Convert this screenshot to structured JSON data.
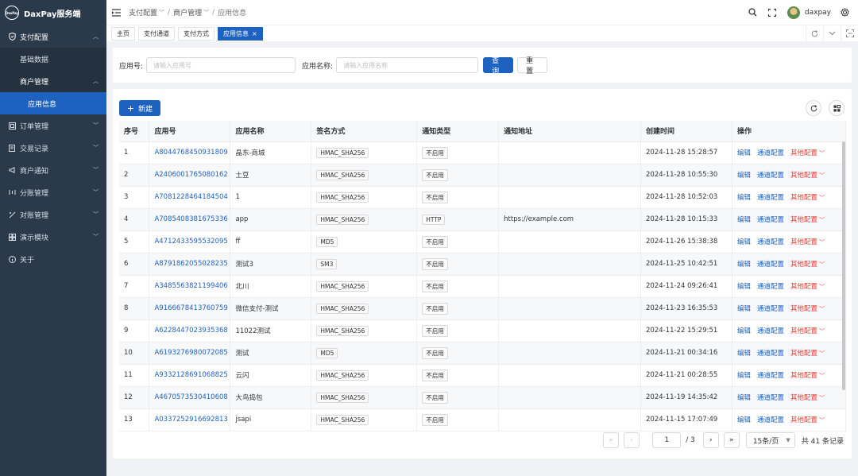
{
  "app": {
    "logo_mark": "DaxPay",
    "title": "DaxPay服务端"
  },
  "sidebar": {
    "items": [
      {
        "label": "支付配置",
        "icon": "shield-icon",
        "state": "expanded"
      },
      {
        "label": "基础数据",
        "level": 1
      },
      {
        "label": "商户管理",
        "level": 1,
        "state": "expanded"
      },
      {
        "label": "应用信息",
        "level": 2,
        "active": true
      },
      {
        "label": "订单管理",
        "icon": "order-icon"
      },
      {
        "label": "交易记录",
        "icon": "record-icon"
      },
      {
        "label": "商户通知",
        "icon": "notify-icon"
      },
      {
        "label": "分账管理",
        "icon": "split-icon"
      },
      {
        "label": "对账管理",
        "icon": "reconcile-icon"
      },
      {
        "label": "演示模块",
        "icon": "demo-icon"
      },
      {
        "label": "关于",
        "icon": "info-icon"
      }
    ]
  },
  "topbar": {
    "breadcrumb": [
      "支付配置",
      "商户管理",
      "应用信息"
    ],
    "username": "daxpay"
  },
  "tabs": [
    {
      "label": "主页"
    },
    {
      "label": "支付通道"
    },
    {
      "label": "支付方式"
    },
    {
      "label": "应用信息",
      "active": true
    }
  ],
  "search": {
    "app_no_label": "应用号:",
    "app_no_placeholder": "请输入应用号",
    "app_name_label": "应用名称:",
    "app_name_placeholder": "请输入应用名称",
    "query_button": "查询",
    "reset_button": "重置"
  },
  "table": {
    "new_button": "新建",
    "columns": [
      "序号",
      "应用号",
      "应用名称",
      "签名方式",
      "通知类型",
      "通知地址",
      "创建时间",
      "操作"
    ],
    "actions": {
      "edit": "编辑",
      "channel_config": "通道配置",
      "other_config": "其他配置"
    },
    "rows": [
      {
        "index": "1",
        "app_no": "A8044768450931809",
        "name": "晶东-商城",
        "sign": "HMAC_SHA256",
        "notify_type": "不启用",
        "notify_url": "",
        "created": "2024-11-28 15:28:57"
      },
      {
        "index": "2",
        "app_no": "A2406001765080162",
        "name": "土豆",
        "sign": "HMAC_SHA256",
        "notify_type": "不启用",
        "notify_url": "",
        "created": "2024-11-28 10:55:30"
      },
      {
        "index": "3",
        "app_no": "A7081228464184504",
        "name": "1",
        "sign": "HMAC_SHA256",
        "notify_type": "不启用",
        "notify_url": "",
        "created": "2024-11-28 10:52:03"
      },
      {
        "index": "4",
        "app_no": "A7085408381675336",
        "name": "app",
        "sign": "HMAC_SHA256",
        "notify_type": "HTTP",
        "notify_url": "https://example.com",
        "created": "2024-11-28 10:15:33"
      },
      {
        "index": "5",
        "app_no": "A4712433595532095",
        "name": "ff",
        "sign": "MD5",
        "notify_type": "不启用",
        "notify_url": "",
        "created": "2024-11-26 15:38:38"
      },
      {
        "index": "6",
        "app_no": "A8791862055028235",
        "name": "测试3",
        "sign": "SM3",
        "notify_type": "不启用",
        "notify_url": "",
        "created": "2024-11-25 10:42:51"
      },
      {
        "index": "7",
        "app_no": "A3485563821199406",
        "name": "北川",
        "sign": "HMAC_SHA256",
        "notify_type": "不启用",
        "notify_url": "",
        "created": "2024-11-24 09:26:41"
      },
      {
        "index": "8",
        "app_no": "A9166678413760759",
        "name": "微信支付-测试",
        "sign": "HMAC_SHA256",
        "notify_type": "不启用",
        "notify_url": "",
        "created": "2024-11-23 16:35:53"
      },
      {
        "index": "9",
        "app_no": "A6228447023935368",
        "name": "11022测试",
        "sign": "HMAC_SHA256",
        "notify_type": "不启用",
        "notify_url": "",
        "created": "2024-11-22 15:29:51"
      },
      {
        "index": "10",
        "app_no": "A6193276980072085",
        "name": "测试",
        "sign": "MD5",
        "notify_type": "不启用",
        "notify_url": "",
        "created": "2024-11-21 00:34:16"
      },
      {
        "index": "11",
        "app_no": "A9332128691068825",
        "name": "云闪",
        "sign": "HMAC_SHA256",
        "notify_type": "不启用",
        "notify_url": "",
        "created": "2024-11-21 00:28:55"
      },
      {
        "index": "12",
        "app_no": "A4670573530410608",
        "name": "大鸟捣包",
        "sign": "HMAC_SHA256",
        "notify_type": "不启用",
        "notify_url": "",
        "created": "2024-11-19 14:35:42"
      },
      {
        "index": "13",
        "app_no": "A0337252916692813",
        "name": "jsapi",
        "sign": "HMAC_SHA256",
        "notify_type": "不启用",
        "notify_url": "",
        "created": "2024-11-15 17:07:49"
      }
    ]
  },
  "pagination": {
    "current_page": "1",
    "total_pages": "/ 3",
    "page_size": "15条/页",
    "total": "共 41 条记录"
  },
  "colors": {
    "primary": "#1e62c0",
    "sidebar_bg": "#2b3a4b",
    "danger": "#e53935"
  }
}
